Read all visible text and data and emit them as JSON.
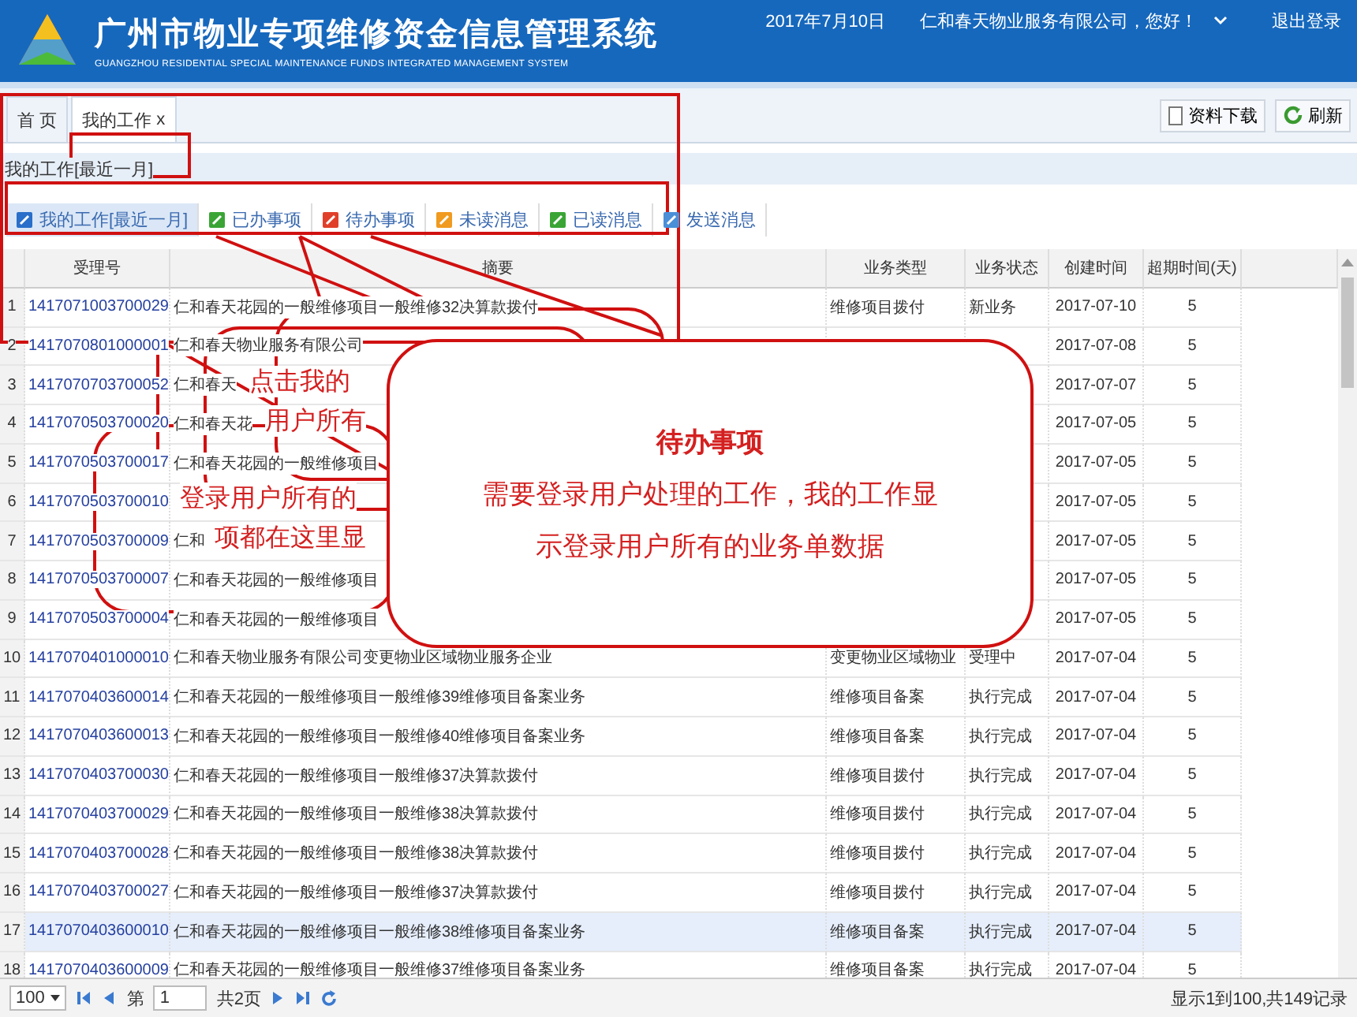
{
  "header": {
    "title": "广州市物业专项维修资金信息管理系统",
    "subtitle": "GUANGZHOU RESIDENTIAL SPECIAL MAINTENANCE FUNDS INTEGRATED MANAGEMENT SYSTEM",
    "date": "2017年7月10日",
    "user": "仁和春天物业服务有限公司，您好！",
    "logout": "退出登录"
  },
  "tabs": [
    {
      "label": "首 页",
      "selected": false
    },
    {
      "label": "我的工作",
      "selected": true,
      "close": "x"
    }
  ],
  "actions": [
    {
      "label": "资料下载",
      "kind": "download"
    },
    {
      "label": "刷新",
      "kind": "refresh"
    }
  ],
  "panel_title": "我的工作[最近一月]",
  "filters": [
    {
      "label": "我的工作[最近一月]",
      "selected": true,
      "color": "#2a6fc9"
    },
    {
      "label": "已办事项",
      "selected": false,
      "color": "#3aa535"
    },
    {
      "label": "待办事项",
      "selected": false,
      "color": "#e0402a"
    },
    {
      "label": "未读消息",
      "selected": false,
      "color": "#f09a20"
    },
    {
      "label": "已读消息",
      "selected": false,
      "color": "#3aa535"
    },
    {
      "label": "发送消息",
      "selected": false,
      "color": "#4a8fd8"
    }
  ],
  "table": {
    "columns": [
      "受理号",
      "摘要",
      "业务类型",
      "业务状态",
      "创建时间",
      "超期时间(天)"
    ],
    "rows": [
      {
        "index": "1",
        "id": "1417071003700029",
        "summary": "仁和春天花园的一般维修项目一般维修32决算款拨付",
        "type": "维修项目拨付",
        "status": "新业务",
        "created": "2017-07-10",
        "overdue": "5",
        "selected": false
      },
      {
        "index": "2",
        "id": "1417070801000001",
        "summary": "仁和春天物业服务有限公司",
        "created": "2017-07-08",
        "overdue": "5",
        "selected": false
      },
      {
        "index": "3",
        "id": "1417070703700052",
        "summary": "仁和春天",
        "created": "2017-07-07",
        "overdue": "5",
        "selected": false
      },
      {
        "index": "4",
        "id": "1417070503700020",
        "summary": "仁和春天花",
        "created": "2017-07-05",
        "overdue": "5",
        "selected": false
      },
      {
        "index": "5",
        "id": "1417070503700017",
        "summary": "仁和春天花园的一般维修项目",
        "created": "2017-07-05",
        "overdue": "5",
        "selected": false
      },
      {
        "index": "6",
        "id": "1417070503700010",
        "created": "2017-07-05",
        "overdue": "5",
        "selected": false
      },
      {
        "index": "7",
        "id": "1417070503700009",
        "summary": "仁和",
        "created": "2017-07-05",
        "overdue": "5",
        "selected": false
      },
      {
        "index": "8",
        "id": "1417070503700007",
        "summary": "仁和春天花园的一般维修项目",
        "created": "2017-07-05",
        "overdue": "5",
        "selected": false
      },
      {
        "index": "9",
        "id": "1417070503700004",
        "summary": "仁和春天花园的一般维修项目",
        "created": "2017-07-05",
        "overdue": "5",
        "selected": false
      },
      {
        "index": "10",
        "id": "1417070401000010",
        "summary": "仁和春天物业服务有限公司变更物业区域物业服务企业",
        "type": "变更物业区域物业",
        "status": "受理中",
        "created": "2017-07-04",
        "overdue": "5",
        "selected": false
      },
      {
        "index": "11",
        "id": "1417070403600014",
        "summary": "仁和春天花园的一般维修项目一般维修39维修项目备案业务",
        "type": "维修项目备案",
        "status": "执行完成",
        "created": "2017-07-04",
        "overdue": "5",
        "selected": false
      },
      {
        "index": "12",
        "id": "1417070403600013",
        "summary": "仁和春天花园的一般维修项目一般维修40维修项目备案业务",
        "type": "维修项目备案",
        "status": "执行完成",
        "created": "2017-07-04",
        "overdue": "5",
        "selected": false
      },
      {
        "index": "13",
        "id": "1417070403700030",
        "summary": "仁和春天花园的一般维修项目一般维修37决算款拨付",
        "type": "维修项目拨付",
        "status": "执行完成",
        "created": "2017-07-04",
        "overdue": "5",
        "selected": false
      },
      {
        "index": "14",
        "id": "1417070403700029",
        "summary": "仁和春天花园的一般维修项目一般维修38决算款拨付",
        "type": "维修项目拨付",
        "status": "执行完成",
        "created": "2017-07-04",
        "overdue": "5",
        "selected": false
      },
      {
        "index": "15",
        "id": "1417070403700028",
        "summary": "仁和春天花园的一般维修项目一般维修38决算款拨付",
        "type": "维修项目拨付",
        "status": "执行完成",
        "created": "2017-07-04",
        "overdue": "5",
        "selected": false
      },
      {
        "index": "16",
        "id": "1417070403700027",
        "summary": "仁和春天花园的一般维修项目一般维修37决算款拨付",
        "type": "维修项目拨付",
        "status": "执行完成",
        "created": "2017-07-04",
        "overdue": "5",
        "selected": false
      },
      {
        "index": "17",
        "id": "1417070403600010",
        "summary": "仁和春天花园的一般维修项目一般维修38维修项目备案业务",
        "type": "维修项目备案",
        "status": "执行完成",
        "created": "2017-07-04",
        "overdue": "5",
        "selected": true
      },
      {
        "index": "18",
        "id": "1417070403600009",
        "summary": "仁和春天花园的一般维修项目一般维修37维修项目备案业务",
        "type": "维修项目备案",
        "status": "执行完成",
        "created": "2017-07-04",
        "overdue": "5",
        "selected": false
      }
    ]
  },
  "pager": {
    "page_size": "100",
    "page_label": "第",
    "page": "1",
    "total_pages": "共2页",
    "summary": "显示1到100,共149记录"
  },
  "callout": {
    "title": "待办事项",
    "lines": [
      "需要登录用户处理的工作，我的工作显",
      "示登录用户所有的业务单数据"
    ]
  },
  "hidden_callout_fragments": [
    "点击我的",
    "用户所有",
    "登录用户所有的",
    "项都在这里显"
  ]
}
